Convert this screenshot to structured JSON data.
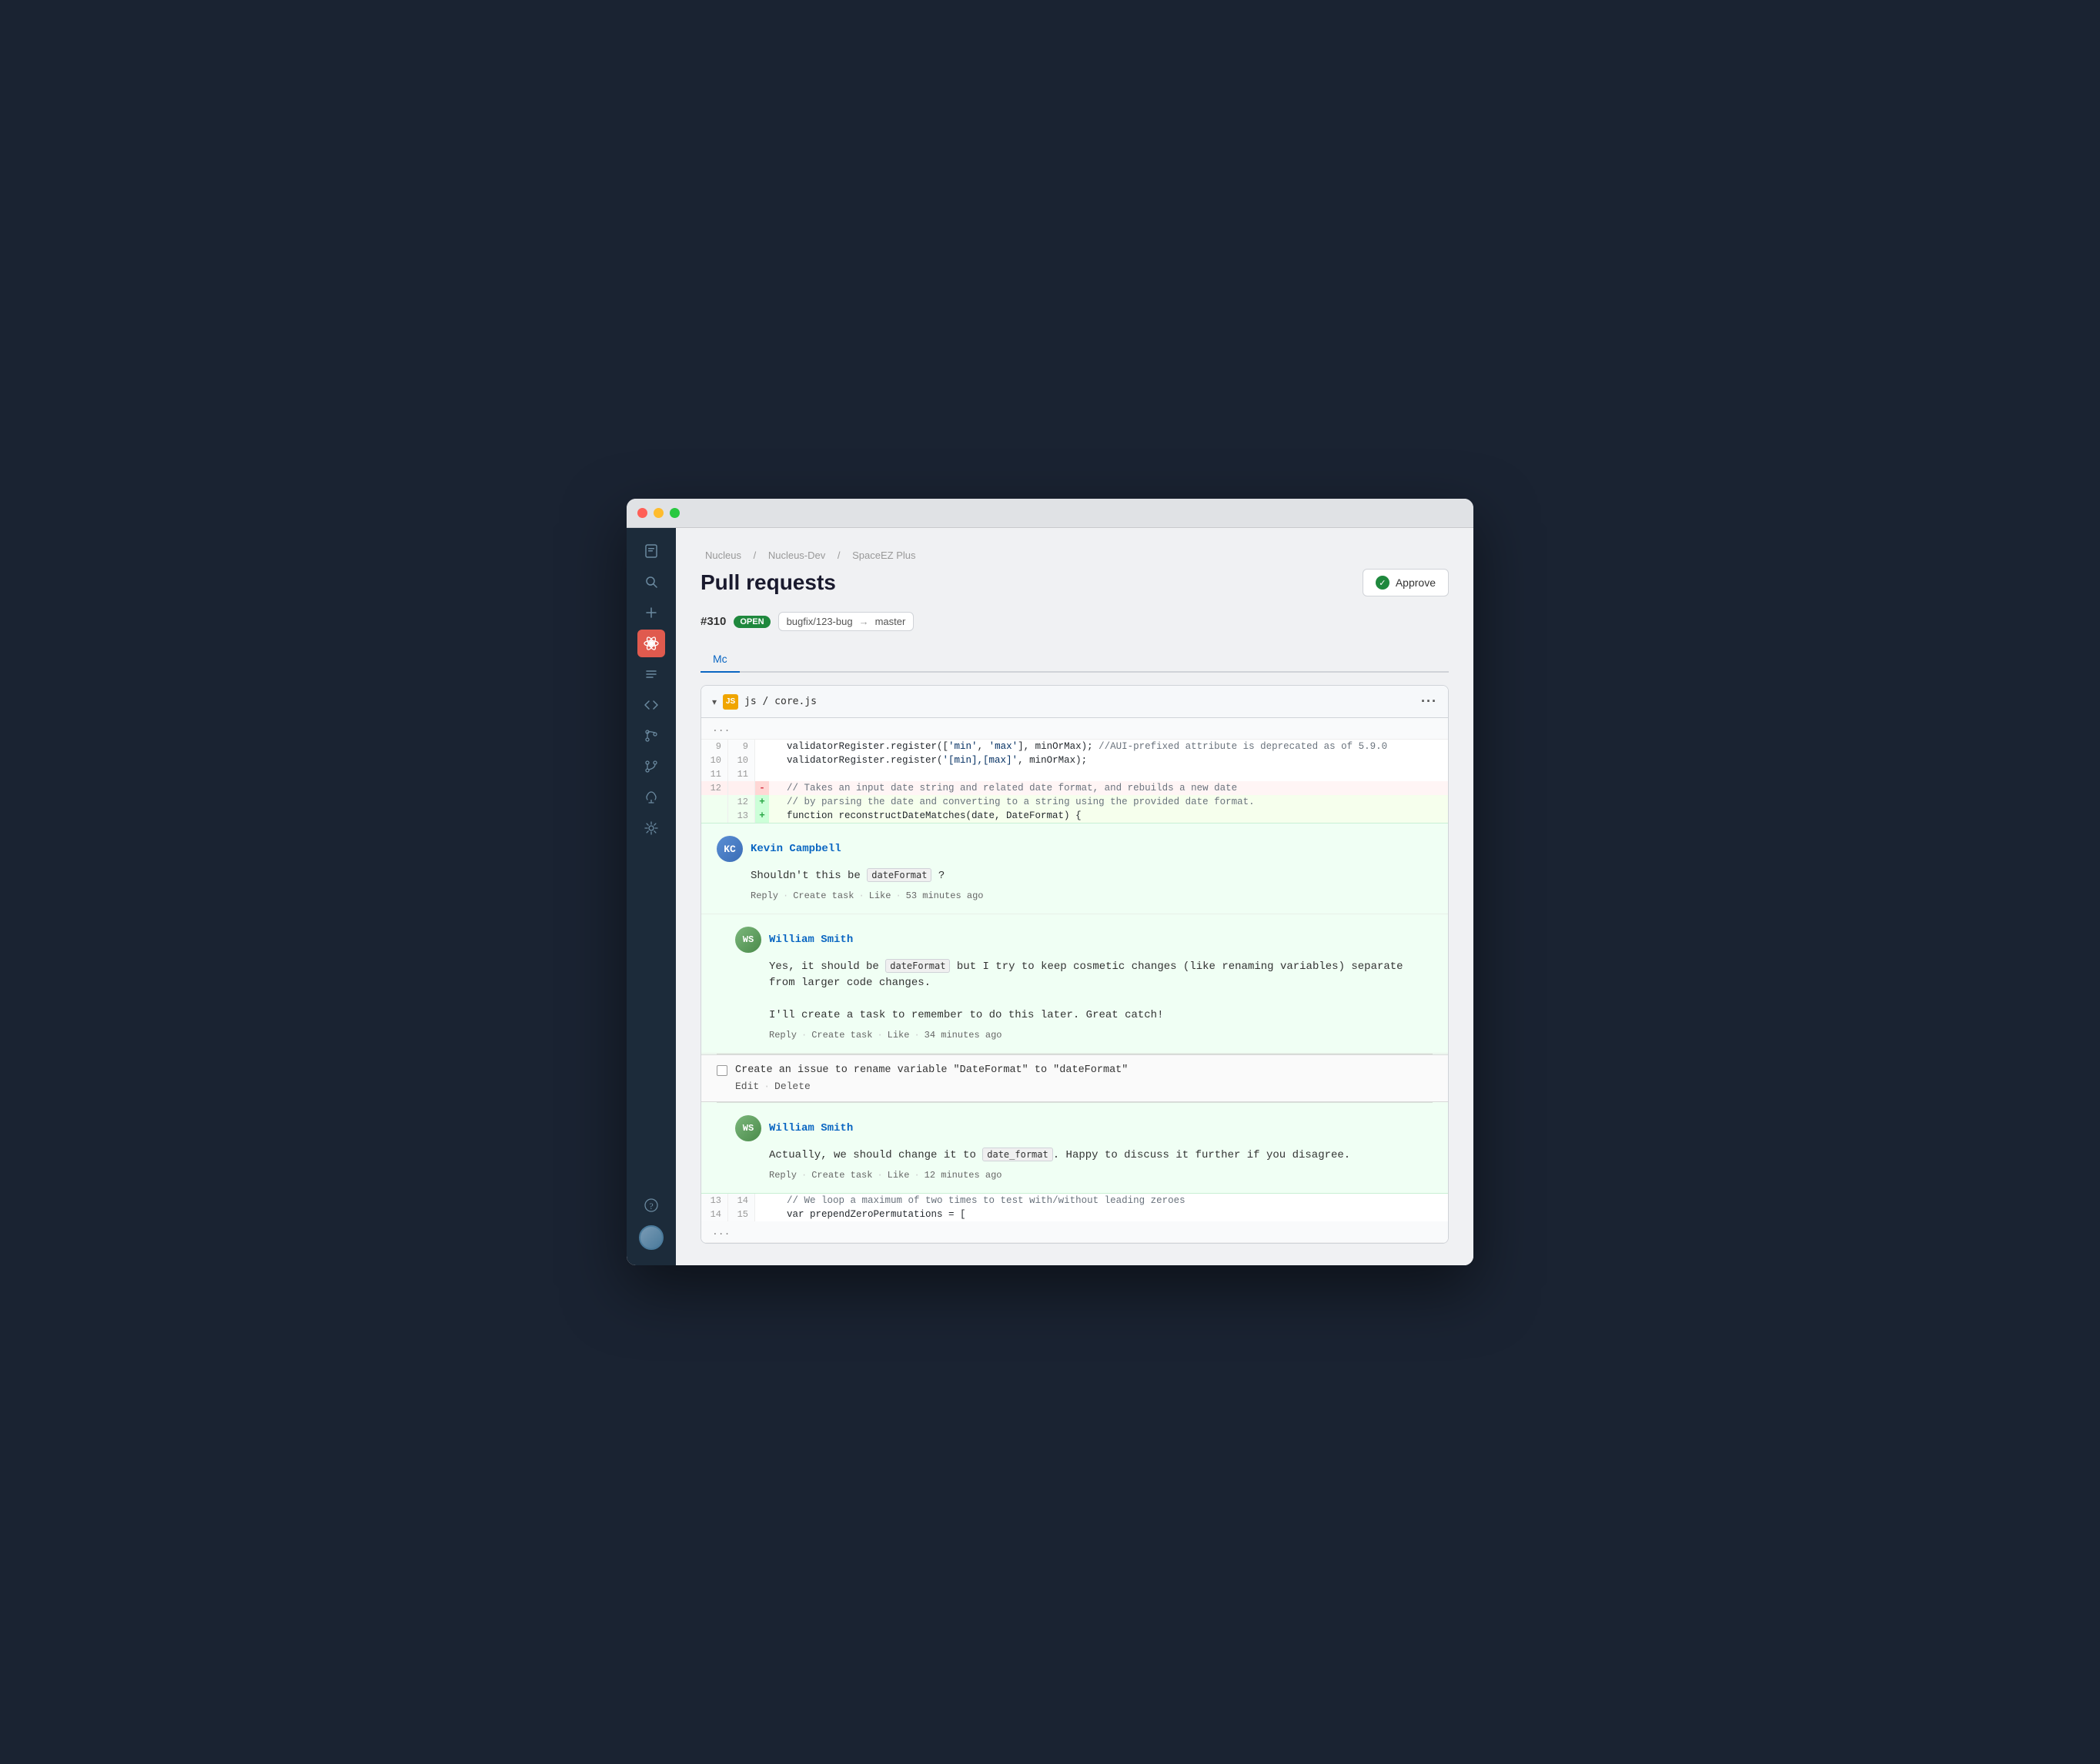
{
  "window": {
    "title": "Pull requests"
  },
  "titlebar": {
    "close": "close",
    "minimize": "minimize",
    "maximize": "maximize"
  },
  "sidebar": {
    "icons": [
      {
        "name": "repository-icon",
        "symbol": "⬢",
        "active": false
      },
      {
        "name": "search-icon",
        "symbol": "⌕",
        "active": false
      },
      {
        "name": "add-icon",
        "symbol": "+",
        "active": false
      },
      {
        "name": "react-icon",
        "symbol": "⚛",
        "active": true
      },
      {
        "name": "list-icon",
        "symbol": "≡",
        "active": false
      },
      {
        "name": "code-icon",
        "symbol": "</>",
        "active": false
      },
      {
        "name": "branch-icon",
        "symbol": "⑂",
        "active": false
      },
      {
        "name": "pr-icon",
        "symbol": "⑂",
        "active": false
      },
      {
        "name": "cloud-icon",
        "symbol": "☁",
        "active": false
      },
      {
        "name": "settings-icon",
        "symbol": "⚙",
        "active": false
      }
    ],
    "bottom": [
      {
        "name": "help-icon",
        "symbol": "?"
      },
      {
        "name": "avatar"
      }
    ]
  },
  "breadcrumb": {
    "parts": [
      "Nucleus",
      "Nucleus-Dev",
      "SpaceEZ Plus"
    ],
    "separators": [
      "/",
      "/"
    ]
  },
  "header": {
    "title": "Pull requests",
    "approve_button": "Approve"
  },
  "pr": {
    "number": "#310",
    "status": "OPEN",
    "source_branch": "bugfix/123-bug",
    "target_branch": "master",
    "tab": "Mc"
  },
  "file_diff": {
    "filename": "js / core.js",
    "file_icon": "JS",
    "lines": [
      {
        "old_num": "9",
        "new_num": "9",
        "type": "context",
        "sign": " ",
        "code": "  validatorRegister.register(['min', 'max'], minOrMax); //AUI-prefixed attribute is deprecated as of 5.9.0"
      },
      {
        "old_num": "10",
        "new_num": "10",
        "type": "context",
        "sign": " ",
        "code": "  validatorRegister.register('[min],[max]', minOrMax);"
      },
      {
        "old_num": "11",
        "new_num": "11",
        "type": "context",
        "sign": " ",
        "code": ""
      },
      {
        "old_num": "12",
        "new_num": "",
        "type": "removed",
        "sign": "-",
        "code": "  // Takes an input date string and related date format, and rebuilds a new date"
      },
      {
        "old_num": "",
        "new_num": "12",
        "type": "added",
        "sign": "+",
        "code": "  // by parsing the date and converting to a string using the provided date format."
      },
      {
        "old_num": "",
        "new_num": "13",
        "type": "added",
        "sign": "+",
        "code": "  function reconstructDateMatches(date, DateFormat) {"
      }
    ],
    "lines_bottom": [
      {
        "old_num": "13",
        "new_num": "14",
        "type": "context",
        "sign": " ",
        "code": "  // We loop a maximum of two times to test with/without leading zeroes"
      },
      {
        "old_num": "14",
        "new_num": "15",
        "type": "context",
        "sign": " ",
        "code": "  var prependZeroPermutations = ["
      }
    ]
  },
  "comments": {
    "thread1": {
      "author": "Kevin Campbell",
      "avatar_initials": "KC",
      "text_before": "Shouldn't this be ",
      "inline_code": "dateFormat",
      "text_after": " ?",
      "actions": [
        "Reply",
        "Create task",
        "Like",
        "53 minutes ago"
      ]
    },
    "thread2": {
      "author": "William Smith",
      "avatar_initials": "WS",
      "text1_before": "Yes, it should be ",
      "inline_code1": "dateFormat",
      "text1_after": " but I try to keep cosmetic changes (like renaming variables) separate from larger code changes.",
      "text2": "I'll create a task to remember to do this later. Great catch!",
      "actions": [
        "Reply",
        "Create task",
        "Like",
        "34 minutes ago"
      ]
    },
    "task": {
      "label": "Create an issue to rename variable \"DateFormat\" to \"dateFormat\"",
      "edit": "Edit",
      "delete": "Delete"
    },
    "thread3": {
      "author": "William Smith",
      "avatar_initials": "WS",
      "text_before": "Actually, we should change it to ",
      "inline_code": "date_format",
      "text_after": ". Happy to discuss it further if you disagree.",
      "actions": [
        "Reply",
        "Create task",
        "Like",
        "12 minutes ago"
      ]
    }
  }
}
